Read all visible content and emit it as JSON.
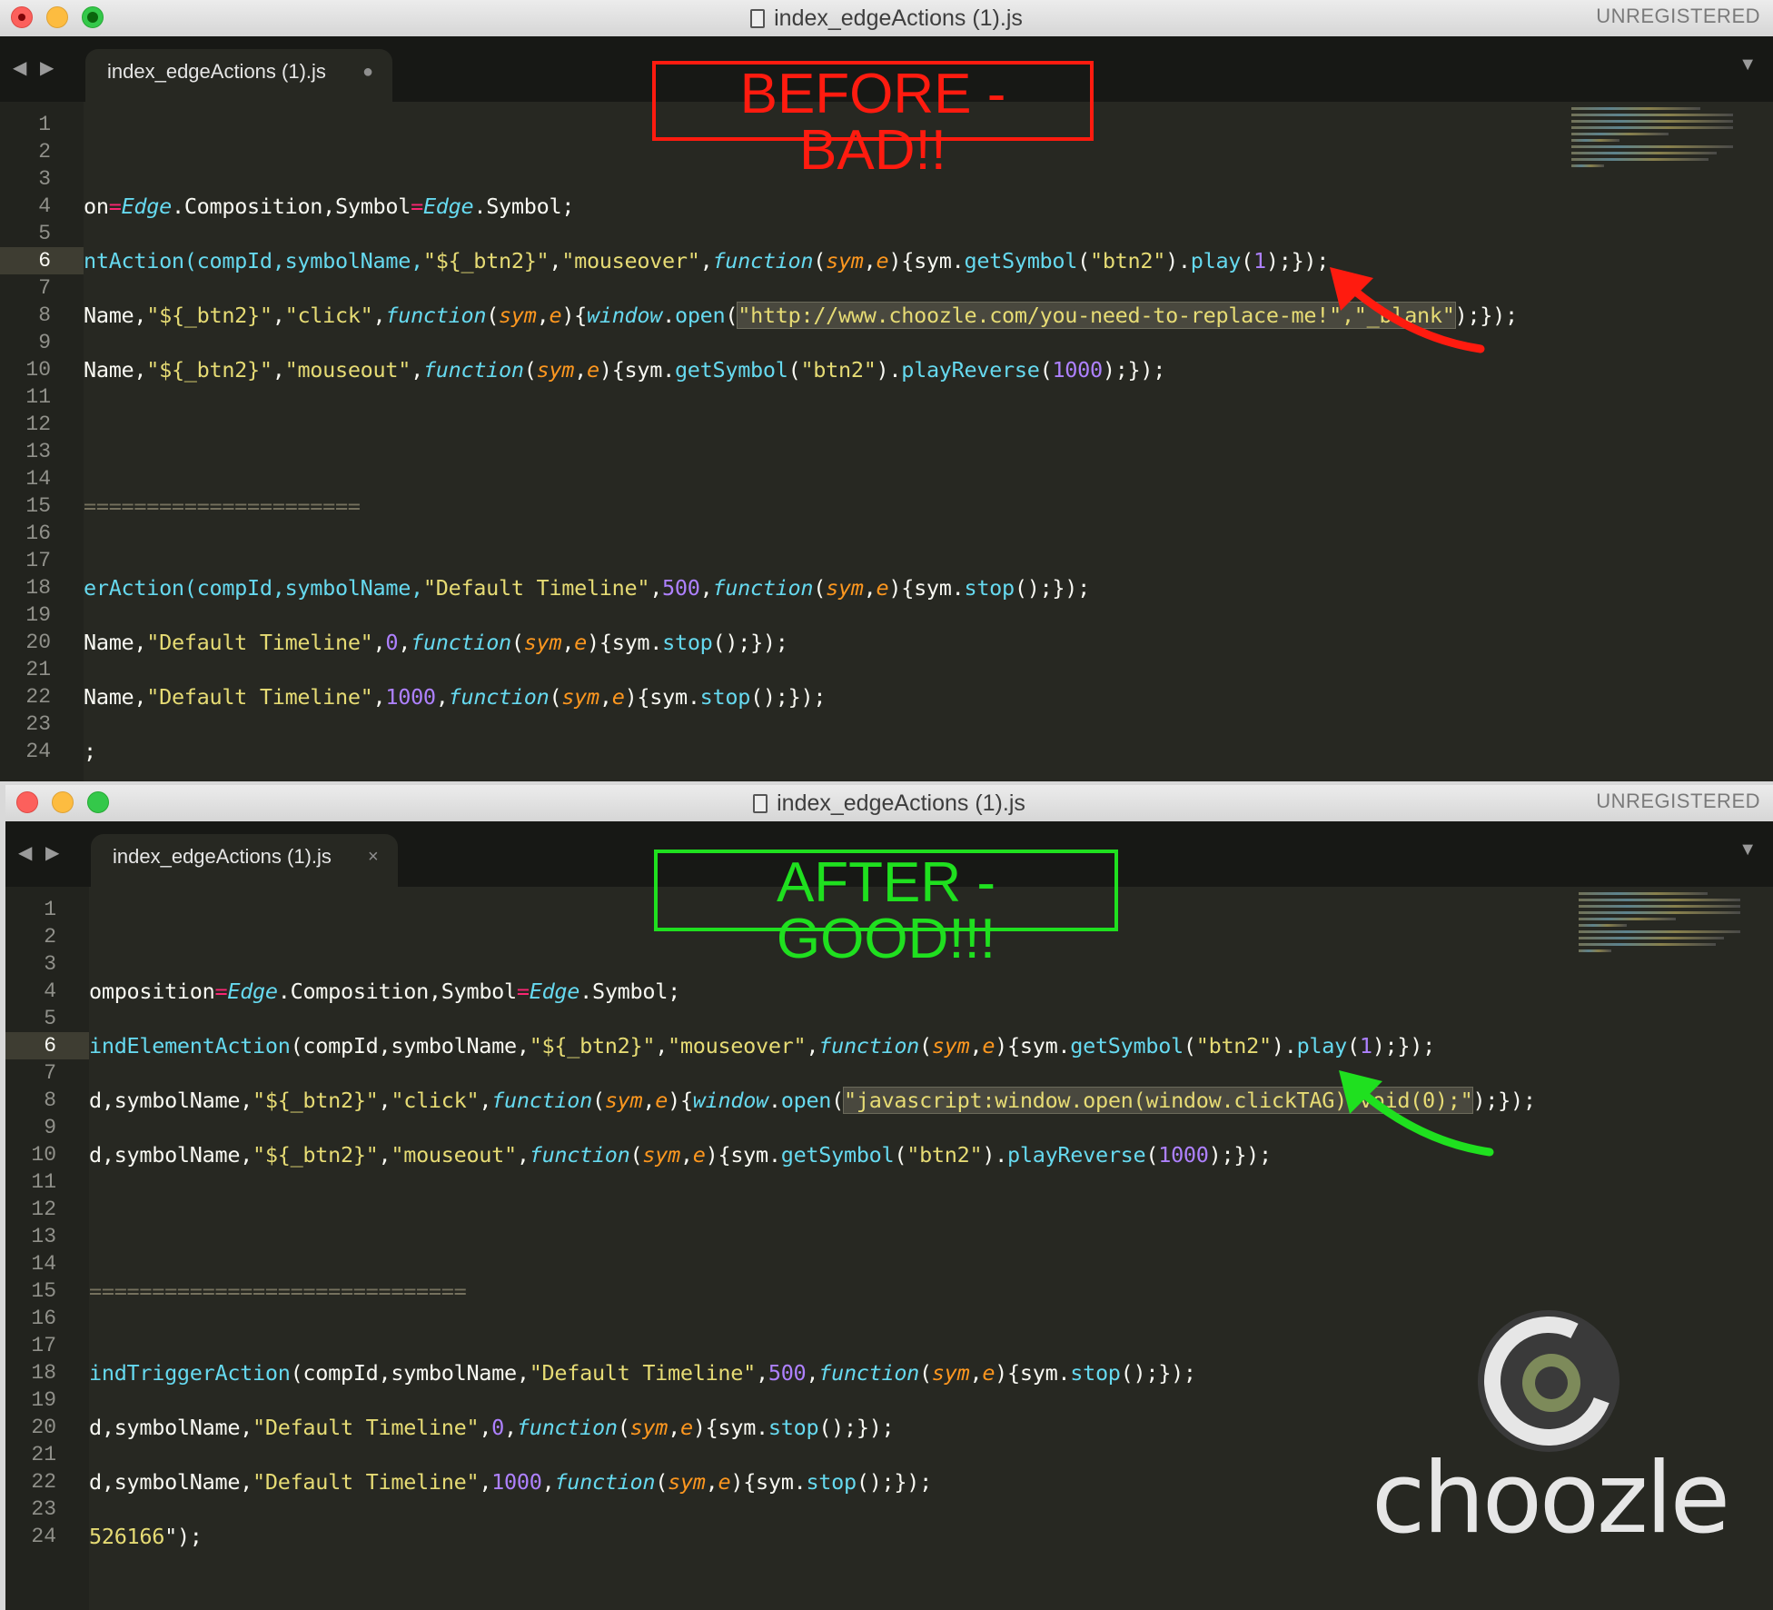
{
  "before": {
    "title": "index_edgeActions (1).js",
    "unregistered": "UNREGISTERED",
    "tab_label": "index_edgeActions (1).js",
    "tab_marker": "●",
    "annotation": "BEFORE - BAD!!",
    "line_numbers": [
      "1",
      "2",
      "3",
      "4",
      "5",
      "6",
      "7",
      "8",
      "9",
      "10",
      "11",
      "12",
      "13",
      "14",
      "15",
      "16",
      "17",
      "18",
      "19",
      "20",
      "21",
      "22",
      "23",
      "24"
    ],
    "current_line": "6"
  },
  "after": {
    "title": "index_edgeActions (1).js",
    "unregistered": "UNREGISTERED",
    "tab_label": "index_edgeActions (1).js",
    "tab_marker": "×",
    "annotation": "AFTER - GOOD!!!",
    "line_numbers": [
      "1",
      "2",
      "3",
      "4",
      "5",
      "6",
      "7",
      "8",
      "9",
      "10",
      "11",
      "12",
      "13",
      "14",
      "15",
      "16",
      "17",
      "18",
      "19",
      "20",
      "21",
      "22",
      "23",
      "24"
    ],
    "current_line": "6"
  },
  "code_before": {
    "l2": [
      "on",
      "=",
      "Edge",
      ".Composition,Symbol",
      "=",
      "Edge",
      ".Symbol;"
    ],
    "l4": [
      "ntAction(compId,symbolName,",
      "\"${_btn2}\"",
      ",",
      "\"mouseover\"",
      ",",
      "function",
      "(",
      "sym",
      ",",
      "e",
      "){sym.",
      "getSymbol",
      "(",
      "\"btn2\"",
      ").",
      "play",
      "(",
      "1",
      ");});"
    ],
    "l6": [
      "Name,",
      "\"${_btn2}\"",
      ",",
      "\"click\"",
      ",",
      "function",
      "(",
      "sym",
      ",",
      "e",
      "){",
      "window",
      ".",
      "open",
      "(",
      "\"http://www.choozle.com/you-need-to-replace-me!\",\"_blank\"",
      ");});"
    ],
    "l8": [
      "Name,",
      "\"${_btn2}\"",
      ",",
      "\"mouseout\"",
      ",",
      "function",
      "(",
      "sym",
      ",",
      "e",
      "){sym.",
      "getSymbol",
      "(",
      "\"btn2\"",
      ").",
      "playReverse",
      "(",
      "1000",
      ");});"
    ],
    "l13": "======================",
    "l16": [
      "erAction(compId,symbolName,",
      "\"Default Timeline\"",
      ",",
      "500",
      ",",
      "function",
      "(",
      "sym",
      ",",
      "e",
      "){sym.",
      "stop",
      "();});"
    ],
    "l18": [
      "Name,",
      "\"Default Timeline\"",
      ",",
      "0",
      ",",
      "function",
      "(",
      "sym",
      ",",
      "e",
      "){sym.",
      "stop",
      "();});"
    ],
    "l20": [
      "Name,",
      "\"Default Timeline\"",
      ",",
      "1000",
      ",",
      "function",
      "(",
      "sym",
      ",",
      "e",
      "){sym.",
      "stop",
      "();});"
    ],
    "l24": ";"
  },
  "code_after": {
    "l2": [
      "omposition",
      "=",
      "Edge",
      ".Composition,Symbol",
      "=",
      "Edge",
      ".Symbol;"
    ],
    "l4": [
      "indElementAction",
      "(compId,symbolName,",
      "\"${_btn2}\"",
      ",",
      "\"mouseover\"",
      ",",
      "function",
      "(",
      "sym",
      ",",
      "e",
      "){sym.",
      "getSymbol",
      "(",
      "\"btn2\"",
      ").",
      "play",
      "(",
      "1",
      ");});"
    ],
    "l6": [
      "d,symbolName,",
      "\"${_btn2}\"",
      ",",
      "\"click\"",
      ",",
      "function",
      "(",
      "sym",
      ",",
      "e",
      "){",
      "window",
      ".",
      "open",
      "(",
      "\"javascript:window.open(window.clickTAG);void(0);\"",
      ");});"
    ],
    "l8": [
      "d,symbolName,",
      "\"${_btn2}\"",
      ",",
      "\"mouseout\"",
      ",",
      "function",
      "(",
      "sym",
      ",",
      "e",
      "){sym.",
      "getSymbol",
      "(",
      "\"btn2\"",
      ").",
      "playReverse",
      "(",
      "1000",
      ");});"
    ],
    "l13": "==============================",
    "l16": [
      "indTriggerAction",
      "(compId,symbolName,",
      "\"Default Timeline\"",
      ",",
      "500",
      ",",
      "function",
      "(",
      "sym",
      ",",
      "e",
      "){sym.",
      "stop",
      "();});"
    ],
    "l18": [
      "d,symbolName,",
      "\"Default Timeline\"",
      ",",
      "0",
      ",",
      "function",
      "(",
      "sym",
      ",",
      "e",
      "){sym.",
      "stop",
      "();});"
    ],
    "l20": [
      "d,symbolName,",
      "\"Default Timeline\"",
      ",",
      "1000",
      ",",
      "function",
      "(",
      "sym",
      ",",
      "e",
      "){sym.",
      "stop",
      "();});"
    ],
    "l24": [
      "526166",
      "\");"
    ]
  },
  "logo": {
    "text": "choozle"
  },
  "colors": {
    "before_accent": "#ff1b0f",
    "after_accent": "#1fe01f",
    "editor_bg": "#272822"
  },
  "icons": [
    "close-light",
    "minimize-light",
    "maximize-light",
    "document-icon",
    "nav-arrow-left-icon",
    "nav-arrow-right-icon",
    "tab-menu-icon",
    "red-arrow",
    "green-arrow"
  ]
}
